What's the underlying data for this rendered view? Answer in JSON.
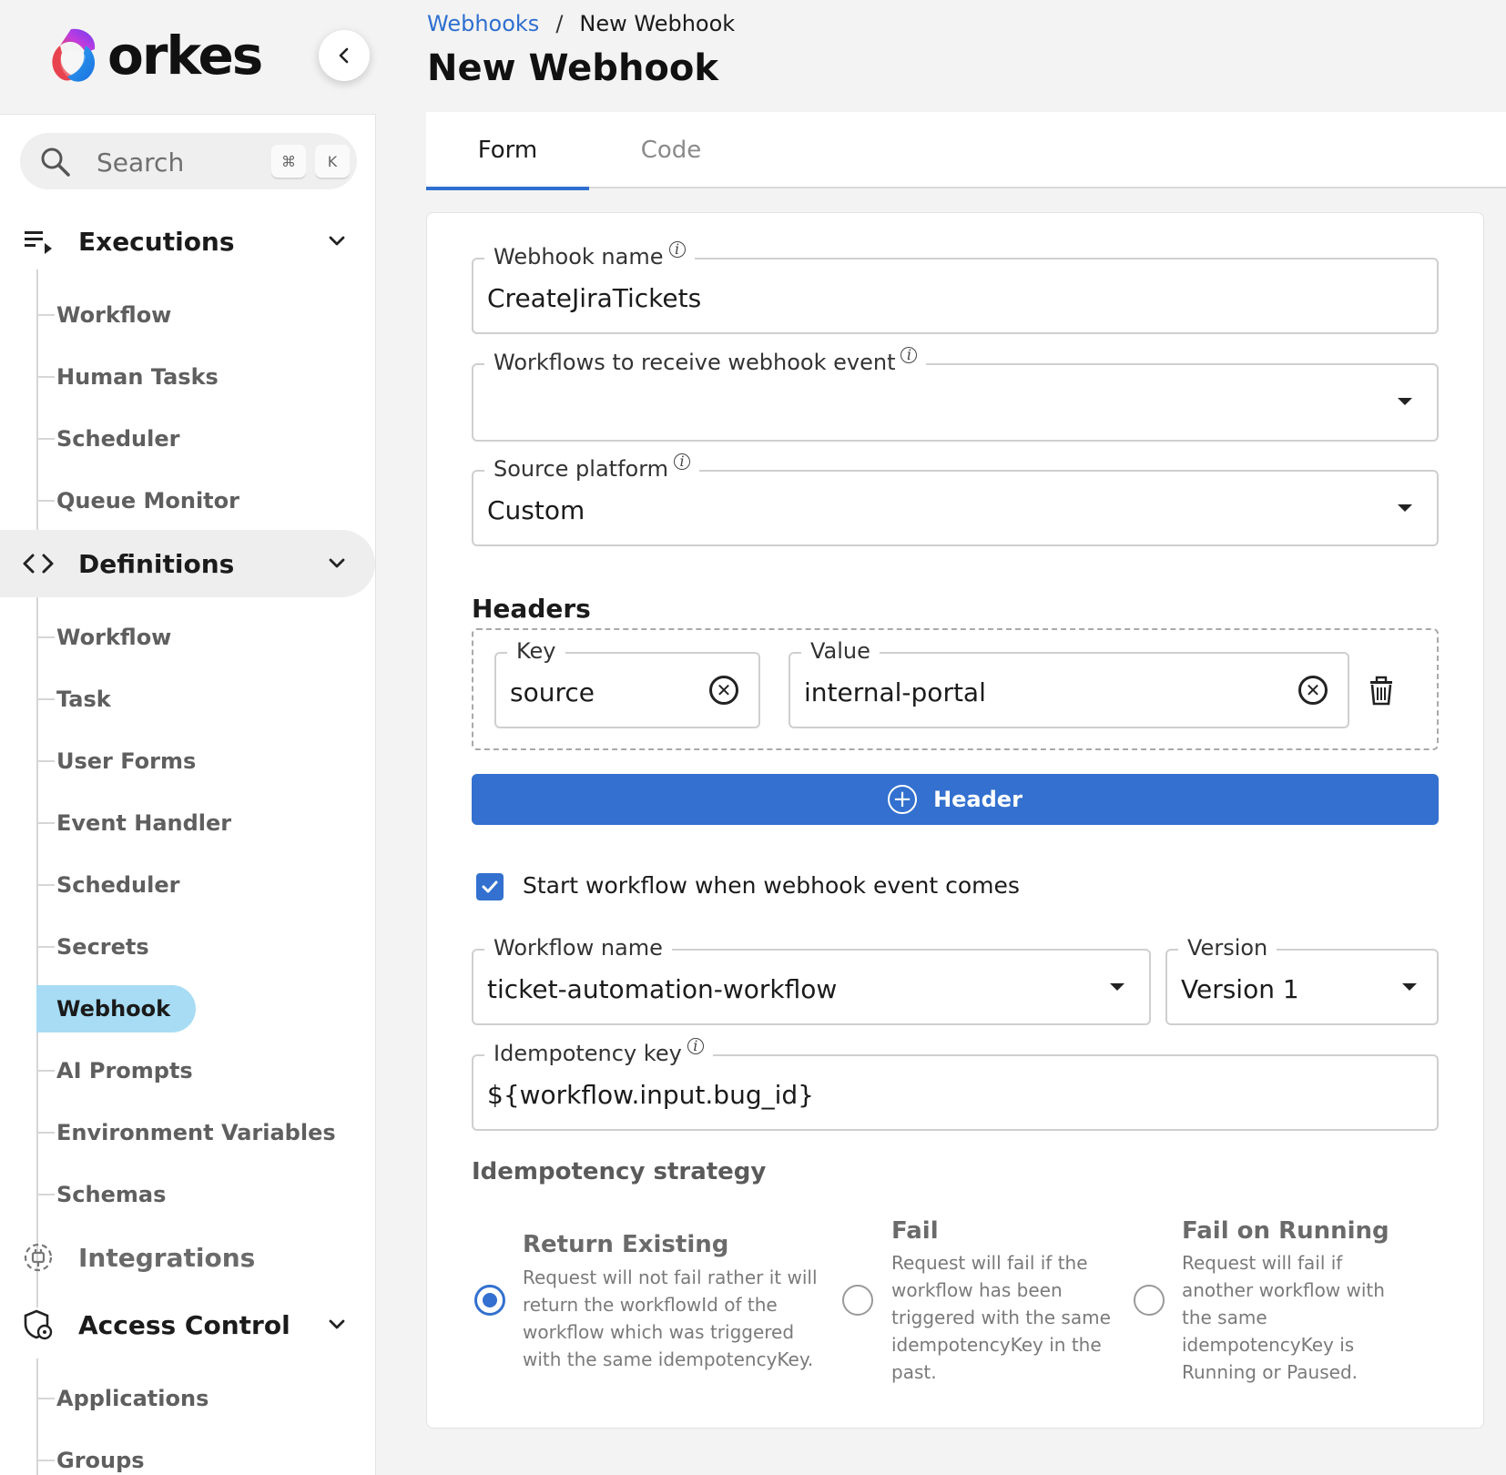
{
  "brand": {
    "name": "orkes"
  },
  "breadcrumb": {
    "parent": "Webhooks",
    "separator": "/",
    "current": "New Webhook"
  },
  "page_title": "New Webhook",
  "sidebar": {
    "search": {
      "placeholder": "Search",
      "shortcut_cmd": "⌘",
      "shortcut_key": "K"
    },
    "executions": {
      "label": "Executions",
      "items": [
        "Workflow",
        "Human Tasks",
        "Scheduler",
        "Queue Monitor"
      ]
    },
    "definitions": {
      "label": "Definitions",
      "items": [
        "Workflow",
        "Task",
        "User Forms",
        "Event Handler",
        "Scheduler",
        "Secrets",
        "Webhook",
        "AI Prompts",
        "Environment Variables",
        "Schemas"
      ]
    },
    "integrations": {
      "label": "Integrations"
    },
    "access_control": {
      "label": "Access Control",
      "items": [
        "Applications",
        "Groups"
      ]
    }
  },
  "tabs": {
    "form": "Form",
    "code": "Code"
  },
  "form": {
    "webhook_name": {
      "label": "Webhook name",
      "value": "CreateJiraTickets"
    },
    "workflows_to_receive": {
      "label": "Workflows to receive webhook event",
      "value": ""
    },
    "source_platform": {
      "label": "Source platform",
      "value": "Custom"
    },
    "headers": {
      "title": "Headers",
      "key_label": "Key",
      "key_value": "source",
      "value_label": "Value",
      "value_value": "internal-portal",
      "add_button": "Header"
    },
    "start_workflow": {
      "label": "Start workflow when webhook event comes",
      "checked": true
    },
    "workflow_name": {
      "label": "Workflow name",
      "value": "ticket-automation-workflow"
    },
    "version": {
      "label": "Version",
      "value": "Version 1"
    },
    "idempotency_key": {
      "label": "Idempotency key",
      "value": "${workflow.input.bug_id}"
    },
    "idempotency_strategy": {
      "title": "Idempotency strategy",
      "selected": "Return Existing",
      "options": [
        {
          "title": "Return Existing",
          "desc_lines": [
            "Request will not fail rather it will",
            "return the workflowId of the",
            "workflow which was triggered",
            "with the same idempotencyKey."
          ]
        },
        {
          "title": "Fail",
          "desc_lines": [
            "Request will fail if the",
            "workflow has been",
            "triggered with the same",
            "idempotencyKey in the",
            "past."
          ]
        },
        {
          "title": "Fail on Running",
          "desc_lines": [
            "Request will fail if",
            "another workflow with",
            "the same",
            "idempotencyKey is",
            "Running or Paused."
          ]
        }
      ]
    }
  },
  "colors": {
    "accent": "#3370cf",
    "active_nav": "#a8dcf4",
    "link": "#2f6fd0"
  }
}
